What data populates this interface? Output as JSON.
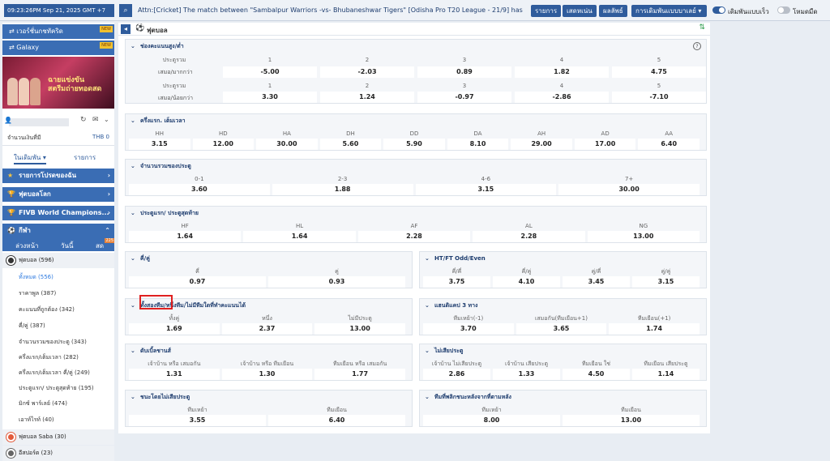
{
  "topbar": {
    "clock": "09:23:26PM Sep 21, 2025 GMT +7",
    "marquee": "Attn:[Cricket] The match between \"Sambalpur Warriors -vs- Bhubaneshwar Tigers\" [Odisha Pro T20 League - 21/9] has been",
    "buttons": [
      "รายการ",
      "เสดหเน่น",
      "ผลลัพธ์",
      "การเดิมพันแบบบาเลย์ ▾"
    ],
    "toggle_fast_label": "เดิมพันแบบเร็ว",
    "toggle_dark_label": "โหมดมืด"
  },
  "sidebar": {
    "top_buttons": [
      {
        "label": "เวอร์ชั่นกชทัคริด",
        "badge": "NEW"
      },
      {
        "label": "Galaxy",
        "badge": "NEW"
      }
    ],
    "banner_text": "ฉายแข่งขัน\nสตรีมถ่ายทอดสด",
    "balance_label": "จำนวนเงินที่มี",
    "balance_currency": "THB 0",
    "tabs": [
      "ในเดิมพัน ▾",
      "รายการ"
    ],
    "categories": [
      {
        "label": "รายการโปรดของฉัน",
        "icon": "★"
      },
      {
        "label": "ฟุตบอลโลก",
        "icon": "🏆"
      },
      {
        "label": "FIVB World Champions...",
        "icon": "🏆"
      },
      {
        "label": "กีฬา",
        "icon": "⚽"
      }
    ],
    "subtabs": [
      "ล่วงหน้า",
      "วันนี้",
      "สด"
    ],
    "live_count": "225",
    "sport_items": [
      {
        "label": "ฟุตบอล",
        "count": "(596)"
      }
    ],
    "sub_items": [
      {
        "label": "ทั้งหมด",
        "count": "(556)",
        "active": true
      },
      {
        "label": "ราคาพูล",
        "count": "(387)"
      },
      {
        "label": "คะแนนที่ถูกต้อง",
        "count": "(342)"
      },
      {
        "label": "คี่/คู่",
        "count": "(387)"
      },
      {
        "label": "จำนวนรวมของประตู",
        "count": "(343)"
      },
      {
        "label": "ครึ่งแรก/เต็มเวลา",
        "count": "(282)"
      },
      {
        "label": "ครึ่งแรก/เต็มเวลา คี่/คู่",
        "count": "(249)"
      },
      {
        "label": "ประตูแรก/ ประตูสุดท้าย",
        "count": "(195)"
      },
      {
        "label": "มิกซ์ พาร์เลย์",
        "count": "(474)"
      },
      {
        "label": "เอาท์ไรท์",
        "count": "(40)"
      }
    ],
    "more_sports": [
      {
        "label": "ฟุตบอล Saba",
        "count": "(30)"
      },
      {
        "label": "อีสปอร์ต",
        "count": "(23)"
      }
    ]
  },
  "main": {
    "title": "ฟุตบอล",
    "ou": {
      "title": "ช่องคะแนนสูง/ต่ำ",
      "row1_label": "ประตูรวม",
      "row1_cols": [
        "1",
        "2",
        "3",
        "4",
        "5"
      ],
      "row1_sub": "เสมอ/มากกว่า",
      "row1_vals": [
        "-5.00",
        "-2.03",
        "0.89",
        "1.82",
        "4.75"
      ],
      "row2_label": "ประตูรวม",
      "row2_cols": [
        "1",
        "2",
        "3",
        "4",
        "5"
      ],
      "row2_sub": "เสมอ/น้อยกว่า",
      "row2_vals": [
        "3.30",
        "1.24",
        "-0.97",
        "-2.86",
        "-7.10"
      ]
    },
    "htft": {
      "title": "ครึ่งแรก. เต็มเวลา",
      "cols": [
        "HH",
        "HD",
        "HA",
        "DH",
        "DD",
        "DA",
        "AH",
        "AD",
        "AA"
      ],
      "vals": [
        "3.15",
        "12.00",
        "30.00",
        "5.60",
        "5.90",
        "8.10",
        "29.00",
        "17.00",
        "6.40"
      ]
    },
    "tg": {
      "title": "จำนวนรวมของประตู",
      "cols": [
        "0-1",
        "2-3",
        "4-6",
        "7+"
      ],
      "vals": [
        "3.60",
        "1.88",
        "3.15",
        "30.00"
      ]
    },
    "fglg": {
      "title": "ประตูแรก/ ประตูสุดท้าย",
      "cols": [
        "HF",
        "HL",
        "AF",
        "AL",
        "NG"
      ],
      "vals": [
        "1.64",
        "1.64",
        "2.28",
        "2.28",
        "13.00"
      ]
    },
    "oe": {
      "title": "คี่/คู่",
      "cols": [
        "คี่",
        "คู่"
      ],
      "vals": [
        "0.97",
        "0.93"
      ]
    },
    "htftoe": {
      "title": "HT/FT Odd/Even",
      "cols": [
        "คี่/คี่",
        "คี่/คู่",
        "คู่/คี่",
        "คู่/คู่"
      ],
      "vals": [
        "3.75",
        "4.10",
        "3.45",
        "3.15"
      ]
    },
    "btts": {
      "title": "ทั้งสองทีม/หนึ่งทีม/ไม่มีทีมใดที่ทำคะแนนได้",
      "cols": [
        "ทั้งคู่",
        "หนึ่ง",
        "ไม่มีประตู"
      ],
      "vals": [
        "1.69",
        "2.37",
        "13.00"
      ]
    },
    "hc3": {
      "title": "แฮนดิแคป 3 ทาง",
      "cols": [
        "ทีมเหย้า(-1)",
        "เสมอกัน(ทีมเยือน+1)",
        "ทีมเยือน(+1)"
      ],
      "vals": [
        "3.70",
        "3.65",
        "1.74"
      ]
    },
    "dc": {
      "title": "ดับเบิ้ลชานส์",
      "cols": [
        "เจ้าบ้าน หรือ เสมอกัน",
        "เจ้าบ้าน หรือ ทีมเยือน",
        "ทีมเยือน หรือ เสมอกัน"
      ],
      "vals": [
        "1.31",
        "1.30",
        "1.77"
      ]
    },
    "cs": {
      "title": "ไม่เสียประตู",
      "cols": [
        "เจ้าบ้าน ไม่เสียประตู",
        "เจ้าบ้าน เสียประตู",
        "ทีมเยือน ใช่",
        "ทีมเยือน เสียประตู"
      ],
      "vals": [
        "2.86",
        "1.33",
        "4.50",
        "1.14"
      ]
    },
    "wtn": {
      "title": "ชนะโดยไม่เสียประตู",
      "cols": [
        "ทีมเหย้า",
        "ทีมเยือน"
      ],
      "vals": [
        "3.55",
        "6.40"
      ]
    },
    "comeback": {
      "title": "ทีมที่พลิกชนะหลังจากที่ตามหลัง",
      "cols": [
        "ทีมเหย้า",
        "ทีมเยือน"
      ],
      "vals": [
        "8.00",
        "13.00"
      ]
    }
  }
}
